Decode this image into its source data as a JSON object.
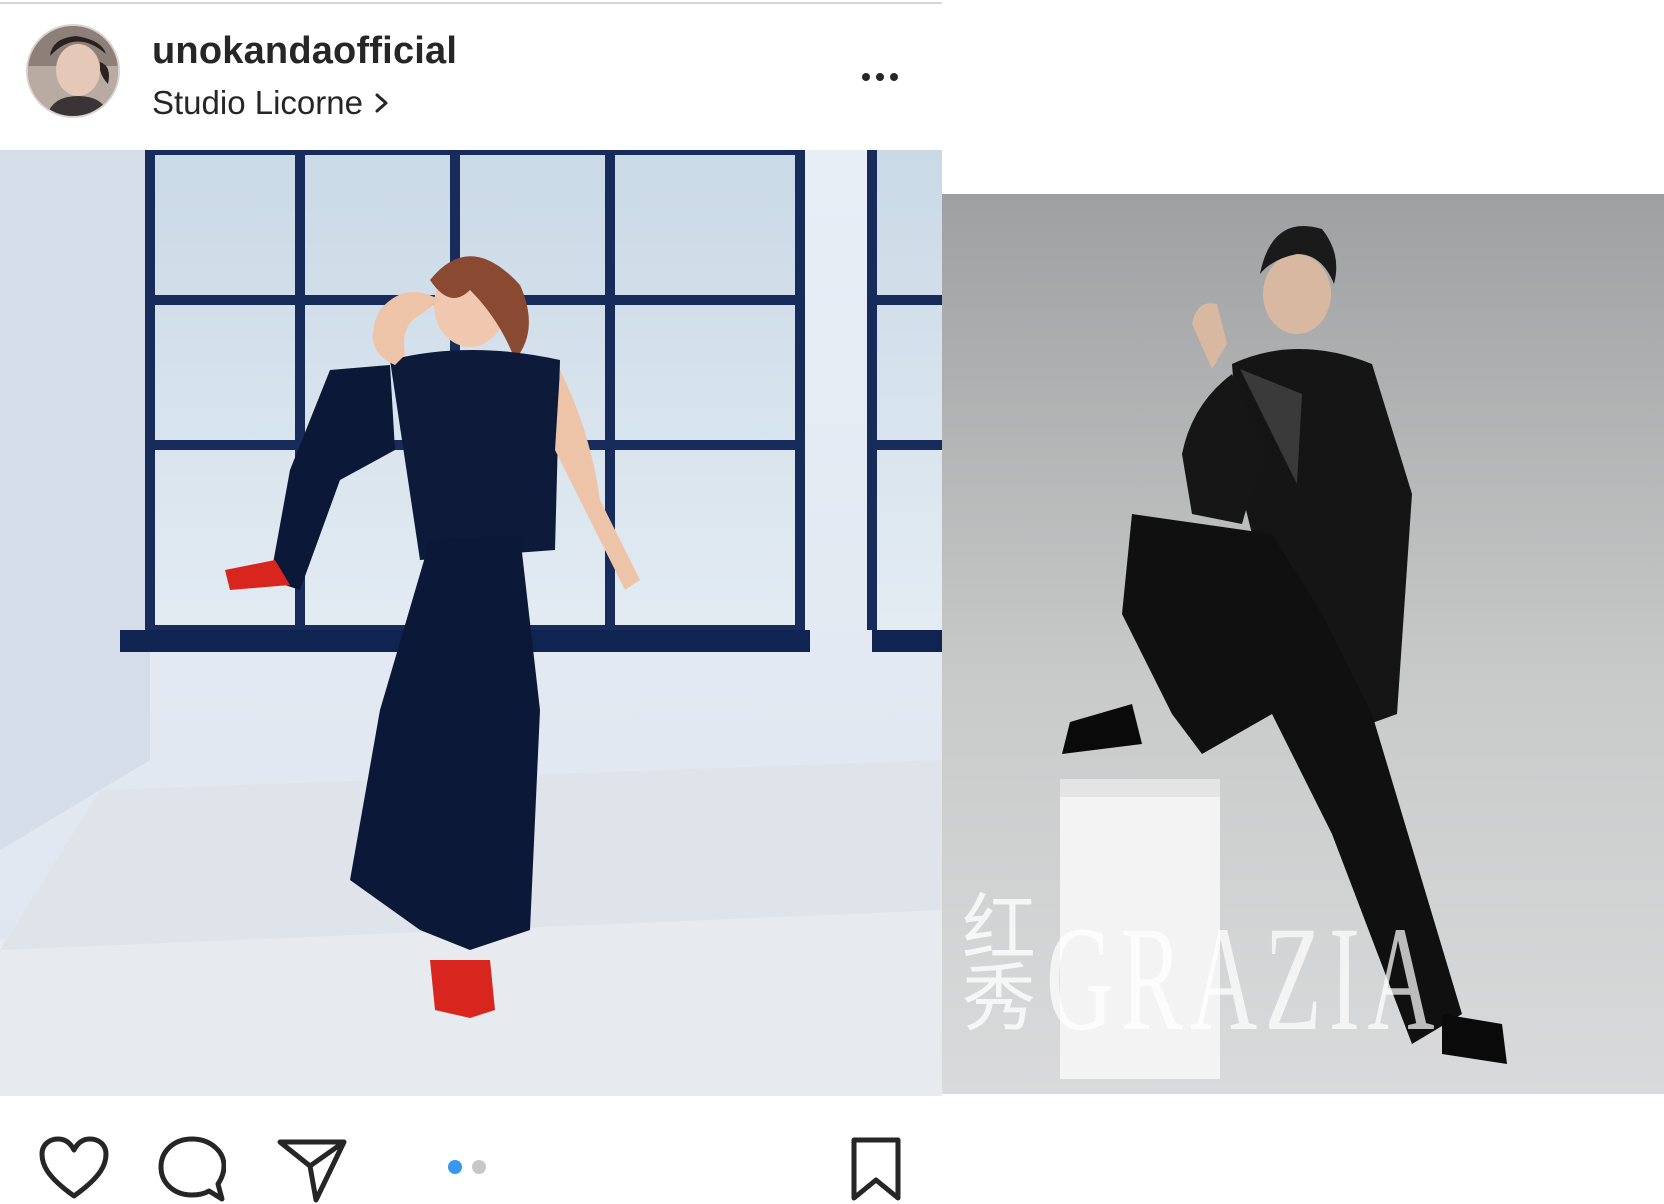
{
  "post": {
    "username": "unokandaofficial",
    "location": "Studio Licorne",
    "icons": {
      "more": "more-options-icon",
      "location_chevron": "chevron-right-icon",
      "like": "heart-icon",
      "comment": "comment-icon",
      "share": "send-icon",
      "save": "bookmark-icon"
    },
    "carousel": {
      "total": 2,
      "active": 1
    },
    "colors": {
      "text": "#262626",
      "active_dot": "#3897f0",
      "inactive_dot": "#c7c7c7"
    }
  },
  "right_image": {
    "watermark": "GRAZIA",
    "watermark_cn": "红秀"
  }
}
